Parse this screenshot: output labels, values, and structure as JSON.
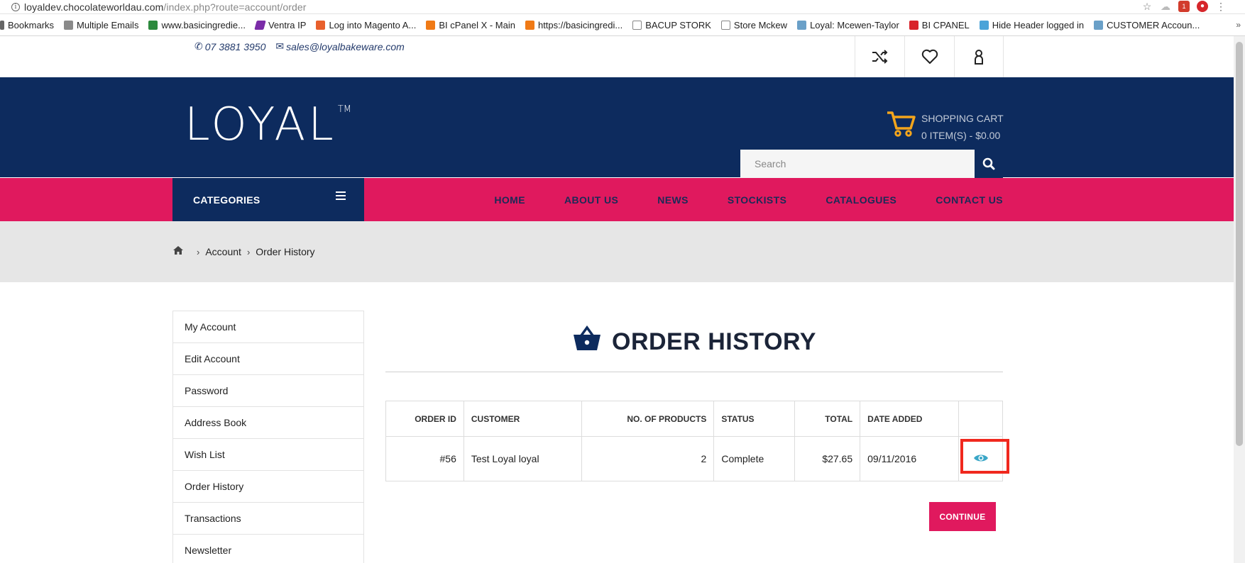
{
  "browser": {
    "url_host": "loyaldev.chocolateworldau.com",
    "url_path": "/index.php?route=account/order",
    "bookmarks": [
      "Bookmarks",
      "Multiple Emails",
      "www.basicingredie...",
      "Ventra IP",
      "Log into Magento A...",
      "BI cPanel X - Main",
      "https://basicingredi...",
      "BACUP STORK",
      "Store Mckew",
      "Loyal: Mcewen-Taylor",
      "BI CPANEL",
      "Hide Header logged in",
      "CUSTOMER Accoun..."
    ],
    "more_glyph": "»"
  },
  "topbar": {
    "phone": "07 3881 3950",
    "email": "sales@loyalbakeware.com"
  },
  "header": {
    "logo": "LOYAL",
    "logo_tm": "TM",
    "cart_title": "SHOPPING CART",
    "cart_summary": "0 ITEM(S) - $0.00",
    "search_placeholder": "Search"
  },
  "nav": {
    "categories_label": "CATEGORIES",
    "links": [
      "HOME",
      "ABOUT US",
      "NEWS",
      "STOCKISTS",
      "CATALOGUES",
      "CONTACT US"
    ]
  },
  "breadcrumb": {
    "items": [
      "Account",
      "Order History"
    ]
  },
  "sidebar": {
    "items": [
      "My Account",
      "Edit Account",
      "Password",
      "Address Book",
      "Wish List",
      "Order History",
      "Transactions",
      "Newsletter"
    ]
  },
  "main": {
    "title": "ORDER HISTORY",
    "table": {
      "headers": [
        "ORDER ID",
        "CUSTOMER",
        "NO. OF PRODUCTS",
        "STATUS",
        "TOTAL",
        "DATE ADDED"
      ],
      "rows": [
        {
          "order_id": "#56",
          "customer": "Test Loyal loyal",
          "products": "2",
          "status": "Complete",
          "total": "$27.65",
          "date": "09/11/2016"
        }
      ]
    },
    "continue_label": "CONTINUE"
  },
  "colors": {
    "navy": "#0d2b5e",
    "pink": "#e0195e",
    "cart_orange": "#f3a51c",
    "view_icon": "#3aa6c7",
    "highlight_red": "#f0281e"
  }
}
